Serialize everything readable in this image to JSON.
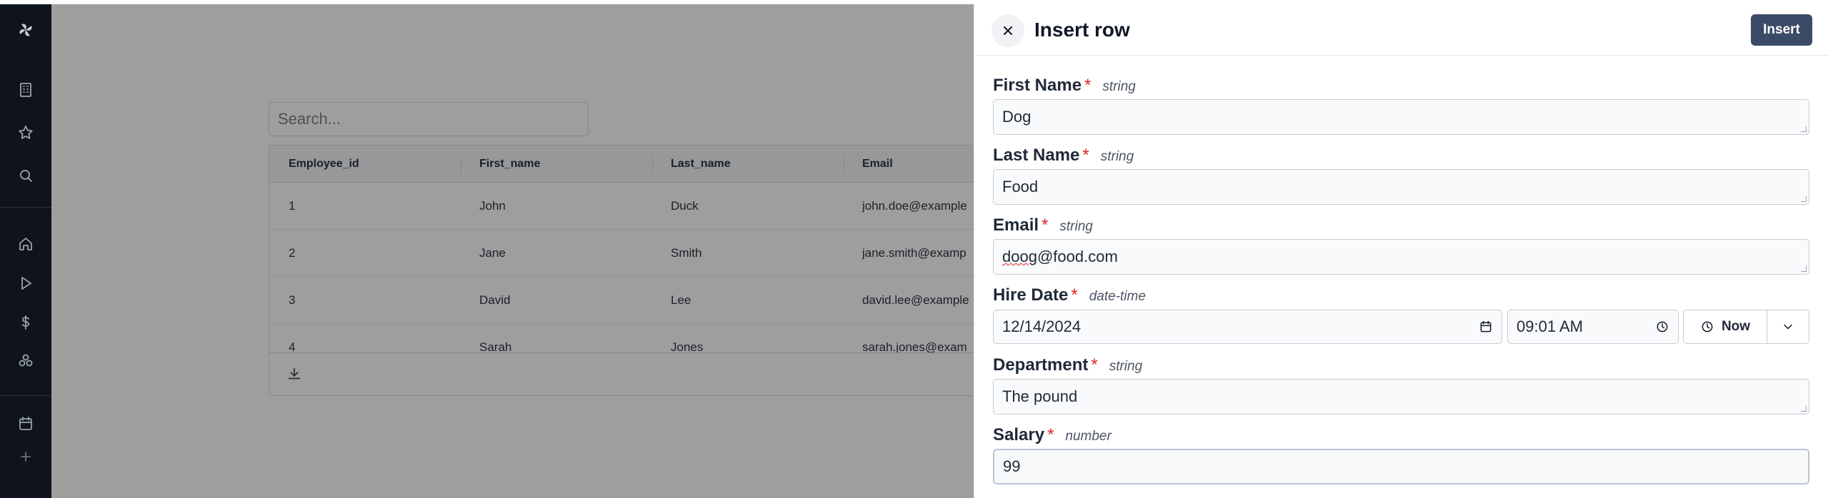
{
  "table": {
    "search_placeholder": "Search...",
    "columns": [
      "Employee_id",
      "First_name",
      "Last_name",
      "Email"
    ],
    "rows": [
      [
        "1",
        "John",
        "Duck",
        "john.doe@example"
      ],
      [
        "2",
        "Jane",
        "Smith",
        "jane.smith@examp"
      ],
      [
        "3",
        "David",
        "Lee",
        "david.lee@example"
      ],
      [
        "4",
        "Sarah",
        "Jones",
        "sarah.jones@exam"
      ]
    ]
  },
  "drawer": {
    "title": "Insert row",
    "insert_label": "Insert",
    "required_mark": "*",
    "fields": {
      "first_name": {
        "label": "First Name",
        "type": "string",
        "value": "Dog"
      },
      "last_name": {
        "label": "Last Name",
        "type": "string",
        "value": "Food"
      },
      "email": {
        "label": "Email",
        "type": "string",
        "value_misspelled": "doog",
        "value_rest": "@food.com"
      },
      "hire_date": {
        "label": "Hire Date",
        "type": "date-time",
        "date": "12/14/2024",
        "time": "09:01 AM",
        "now_label": "Now"
      },
      "department": {
        "label": "Department",
        "type": "string",
        "value": "The pound"
      },
      "salary": {
        "label": "Salary",
        "type": "number",
        "value": "99"
      }
    }
  },
  "icons": {
    "sidebar": [
      "logo-icon",
      "building-icon",
      "star-icon",
      "search-icon",
      "home-icon",
      "play-icon",
      "dollar-icon",
      "components-icon",
      "calendar-icon",
      "plus-icon"
    ]
  },
  "colors": {
    "sidebar_bg": "#0f141c",
    "insert_button": "#3b4a66",
    "required": "#dc2626",
    "overlay": "rgba(40,40,40,0.45)"
  }
}
